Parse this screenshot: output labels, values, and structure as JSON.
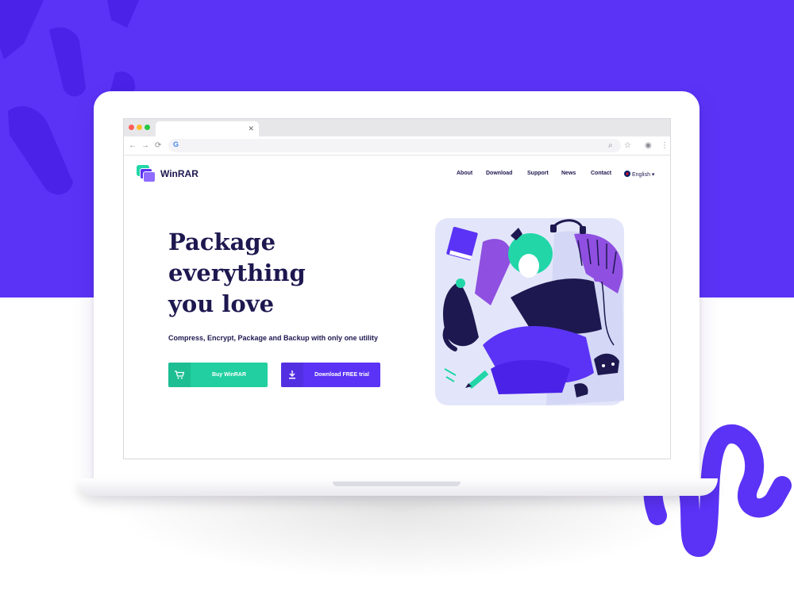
{
  "colors": {
    "brand_purple": "#5b33f6",
    "brand_green": "#21cfa0",
    "text_dark": "#1e1850",
    "background": "#ffffff"
  },
  "browser": {
    "tab_close_icon": "close-icon",
    "address_icon": "G"
  },
  "site": {
    "brand": "WinRAR",
    "nav": [
      {
        "label": "About"
      },
      {
        "label": "Download"
      },
      {
        "label": "Support"
      },
      {
        "label": "News"
      },
      {
        "label": "Contact"
      }
    ],
    "language": "English"
  },
  "hero": {
    "title_lines": [
      "Package",
      "everything",
      "you love"
    ],
    "subtitle": "Compress, Encrypt, Package and Backup with only one utility",
    "buy_label": "Buy WinRAR",
    "trial_label": "Download FREE trial"
  }
}
